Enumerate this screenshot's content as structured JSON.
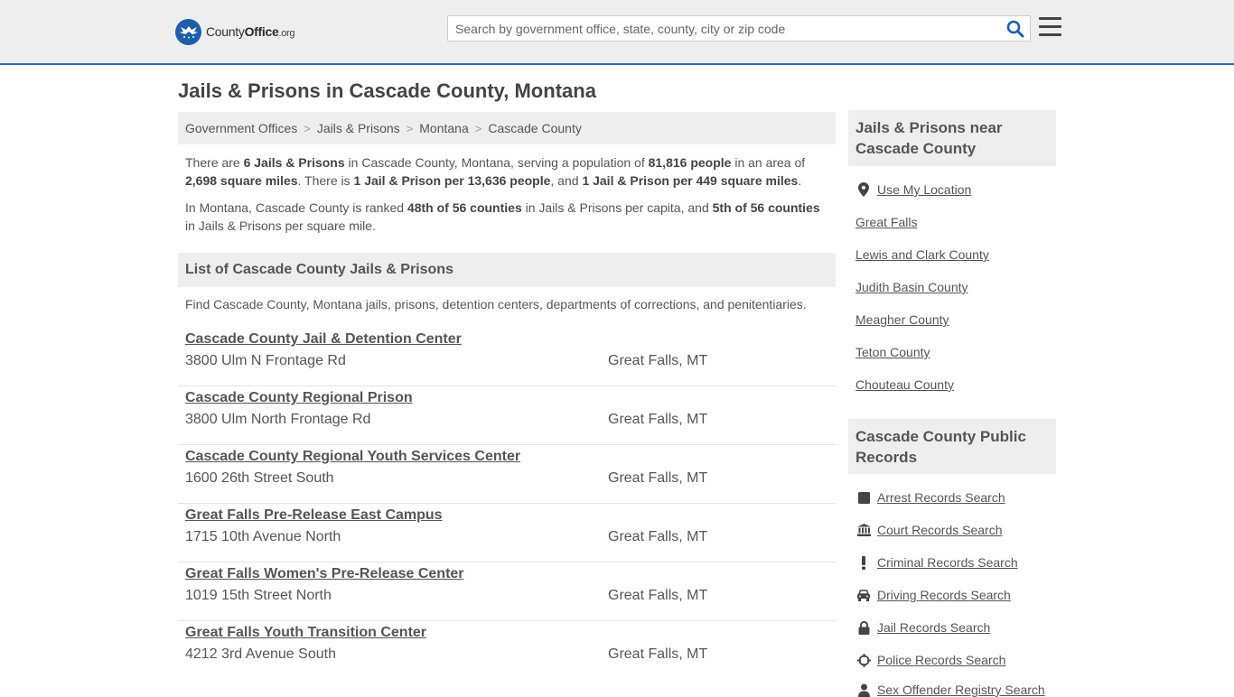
{
  "header": {
    "logo_county": "County",
    "logo_office": "Office",
    "logo_org": ".org",
    "search_placeholder": "Search by government office, state, county, city or zip code"
  },
  "page": {
    "title": "Jails & Prisons in Cascade County, Montana"
  },
  "breadcrumb": [
    "Government Offices",
    "Jails & Prisons",
    "Montana",
    "Cascade County"
  ],
  "summary": {
    "p1_t1": "There are ",
    "p1_b1": "6 Jails & Prisons",
    "p1_t2": " in Cascade County, Montana, serving a population of ",
    "p1_b2": "81,816 people",
    "p1_t3": " in an area of ",
    "p1_b3": "2,698 square miles",
    "p1_t4": ". There is ",
    "p1_b4": "1 Jail & Prison per 13,636 people",
    "p1_t5": ", and ",
    "p1_b5": "1 Jail & Prison per 449 square miles",
    "p1_t6": ".",
    "p2_t1": "In Montana, Cascade County is ranked ",
    "p2_b1": "48th of 56 counties",
    "p2_t2": " in Jails & Prisons per capita, and ",
    "p2_b2": "5th of 56 counties",
    "p2_t3": " in Jails & Prisons per square mile."
  },
  "list_section": {
    "title": "List of Cascade County Jails & Prisons",
    "description": "Find Cascade County, Montana jails, prisons, detention centers, departments of corrections, and penitentiaries."
  },
  "listings": [
    {
      "name": "Cascade County Jail & Detention Center",
      "address": "3800 Ulm N Frontage Rd",
      "city": "Great Falls, MT"
    },
    {
      "name": "Cascade County Regional Prison",
      "address": "3800 Ulm North Frontage Rd",
      "city": "Great Falls, MT"
    },
    {
      "name": "Cascade County Regional Youth Services Center",
      "address": "1600 26th Street South",
      "city": "Great Falls, MT"
    },
    {
      "name": "Great Falls Pre-Release East Campus",
      "address": "1715 10th Avenue North",
      "city": "Great Falls, MT"
    },
    {
      "name": "Great Falls Women's Pre-Release Center",
      "address": "1019 15th Street North",
      "city": "Great Falls, MT"
    },
    {
      "name": "Great Falls Youth Transition Center",
      "address": "4212 3rd Avenue South",
      "city": "Great Falls, MT"
    }
  ],
  "sidebar": {
    "nearby_title": "Jails & Prisons near Cascade County",
    "use_location": "Use My Location",
    "nearby": [
      "Great Falls",
      "Lewis and Clark County",
      "Judith Basin County",
      "Meagher County",
      "Teton County",
      "Chouteau County"
    ],
    "records_title": "Cascade County Public Records",
    "records": [
      {
        "label": "Arrest Records Search",
        "icon": "square-icon"
      },
      {
        "label": "Court Records Search",
        "icon": "courthouse-icon"
      },
      {
        "label": "Criminal Records Search",
        "icon": "exclamation-icon"
      },
      {
        "label": "Driving Records Search",
        "icon": "car-icon"
      },
      {
        "label": "Jail Records Search",
        "icon": "lock-icon"
      },
      {
        "label": "Police Records Search",
        "icon": "crosshair-icon"
      },
      {
        "label": "Sex Offender Registry Search",
        "icon": "person-icon"
      }
    ]
  },
  "colors": {
    "header_bg": "#eeeeee",
    "accent_border": "#2b6cb0",
    "search_icon": "#1f5faa",
    "text": "#555555"
  }
}
